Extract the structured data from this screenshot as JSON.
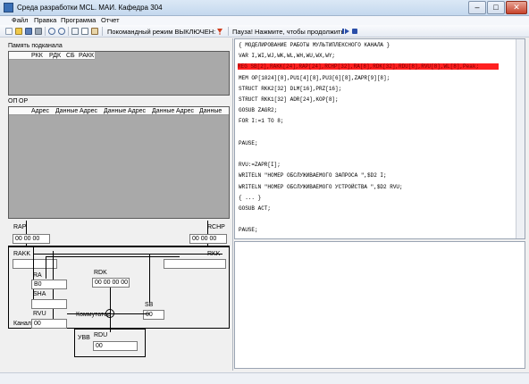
{
  "window": {
    "title": "Среда разработки MCL. МАИ. Кафедра 304",
    "minimize": "–",
    "maximize": "□",
    "close": "✕"
  },
  "menu": [
    "Файл",
    "Правка",
    "Программа",
    "Отчет"
  ],
  "toolbar": {
    "command_mode": "Покомандный режим ВЫКЛЮЧЕН:",
    "pause_text": "Пауза! Нажмите, чтобы продолжить:",
    "icons": [
      "new-icon",
      "open-icon",
      "save-icon",
      "print-icon",
      "undo-icon",
      "redo-icon",
      "cut-icon",
      "copy-icon",
      "paste-icon",
      "command-mode-icon",
      "continue-icon",
      "stop-icon"
    ]
  },
  "subchannel_memory": {
    "title": "Память подканала",
    "columns": [
      "РКК",
      "РДК",
      "СБ",
      "РАКК"
    ]
  },
  "op_memory": {
    "labels": [
      "ОП",
      "ОР"
    ],
    "columns": [
      "Адрес",
      "Данные",
      "Адрес",
      "Данные",
      "Адрес",
      "Данные",
      "Адрес",
      "Данные"
    ]
  },
  "registers": {
    "rap_label": "RAP",
    "rap_value": "00 00 00",
    "rchp_label": "RCHP",
    "rchp_value": "00 00 00",
    "rakk_label": "RAKK",
    "rakk_value": "",
    "rkk_label": "RKK",
    "rkk_value": "",
    "ra_label": "RA",
    "ra_value": "B0",
    "rdk_label": "RDK",
    "rdk_value": "00 00 00 00",
    "sha_label": "SHA",
    "sha_value": "",
    "sb_label": "SB",
    "sb_value": "00",
    "rvu_label": "RVU",
    "rvu_value": "00",
    "switch_label": "Коммутатор",
    "channel_label": "Канал",
    "uvv_label": "УВВ",
    "rdu_label": "RDU",
    "rdu_value": "00"
  },
  "code": [
    "{ МОДЕЛИРОВАНИЕ РАБОТЫ МУЛЬТИПЛЕКСНОГО КАНАЛА }",
    "VAR I,WI,WJ,WK,WL,WH,WU,WX,WY;",
    "REG SB[2],RAKK[24],RAP[24],RCHP[32],RA[8],RDK[32],RDU[8],RVU[8],WL[8],Peak;",
    "MEM OP[1024][8],PU1[4][8],PU3[6][8],ZAPR[9][8];",
    "STRUCT RKK2[32] DLM[16],PRZ[16];",
    "STRUCT RKK1[32] ADR[24],KOP[8];",
    " GOSUB ZAGR2;",
    " FOR I:=1 TO 8;",
    "",
    "PAUSE;",
    "",
    " RVU:=ZAPR[I];",
    " WRITELN \"НОМЕР ОБСЛУЖИВАЕМОГО ЗАПРОСА \",$D2 I;",
    " WRITELN \"НОМЕР ОБСЛУЖИВАЕМОГО УСТРОЙСТВА \",$D2 RVU;",
    "{  ...  }",
    "GOSUB ACT;",
    "",
    "PAUSE;"
  ],
  "highlight_line": 2,
  "colors": {
    "highlight": "#ff2020",
    "grid_bg": "#a9a9a9"
  }
}
